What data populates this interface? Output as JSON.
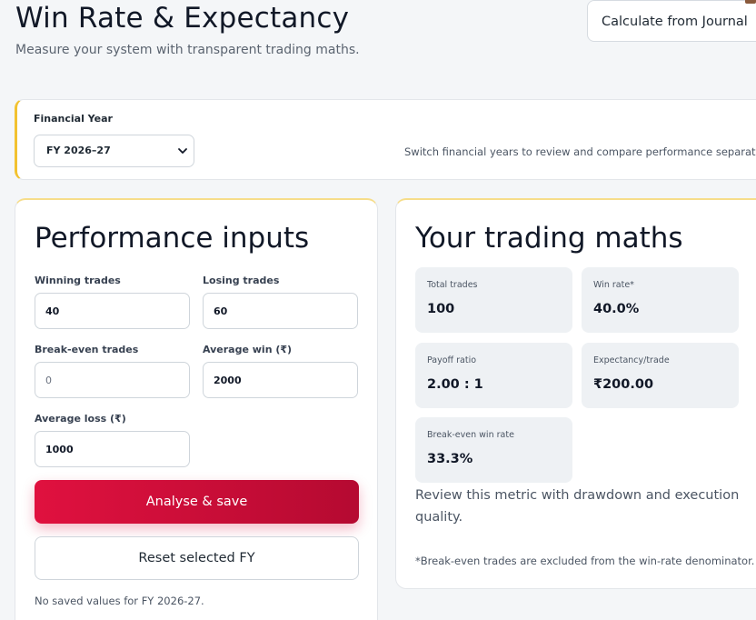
{
  "header": {
    "title": "Win Rate & Expectancy",
    "subtitle": "Measure your system with transparent trading maths.",
    "journal_button": "Calculate from Journal"
  },
  "financial_year": {
    "label": "Financial Year",
    "selected": "FY 2026–27",
    "hint": "Switch financial years to review and compare performance separately."
  },
  "inputs": {
    "heading": "Performance inputs",
    "fields": {
      "winning_trades": {
        "label": "Winning trades",
        "value": "40"
      },
      "losing_trades": {
        "label": "Losing trades",
        "value": "60"
      },
      "breakeven_trades": {
        "label": "Break-even trades",
        "value": "",
        "placeholder": "0"
      },
      "average_win": {
        "label": "Average win (₹)",
        "value": "2000"
      },
      "average_loss": {
        "label": "Average loss (₹)",
        "value": "1000"
      }
    },
    "analyse_button": "Analyse & save",
    "reset_button": "Reset selected FY",
    "status": "No saved values for FY 2026-27."
  },
  "maths": {
    "heading": "Your trading maths",
    "metrics": {
      "total_trades": {
        "label": "Total trades",
        "value": "100"
      },
      "win_rate": {
        "label": "Win rate*",
        "value": "40.0%"
      },
      "payoff_ratio": {
        "label": "Payoff ratio",
        "value": "2.00 : 1"
      },
      "expectancy": {
        "label": "Expectancy/trade",
        "value": "₹200.00"
      },
      "breakeven_win_rate": {
        "label": "Break-even win rate",
        "value": "33.3%"
      }
    },
    "review": "Review this metric with drawdown and execution quality.",
    "footnote": "*Break-even trades are excluded from the win-rate denominator."
  },
  "colors": {
    "accent": "#f2c230",
    "primary_button_start": "#e0113f",
    "primary_button_end": "#b50a31",
    "tile_background": "#eef1f4"
  }
}
